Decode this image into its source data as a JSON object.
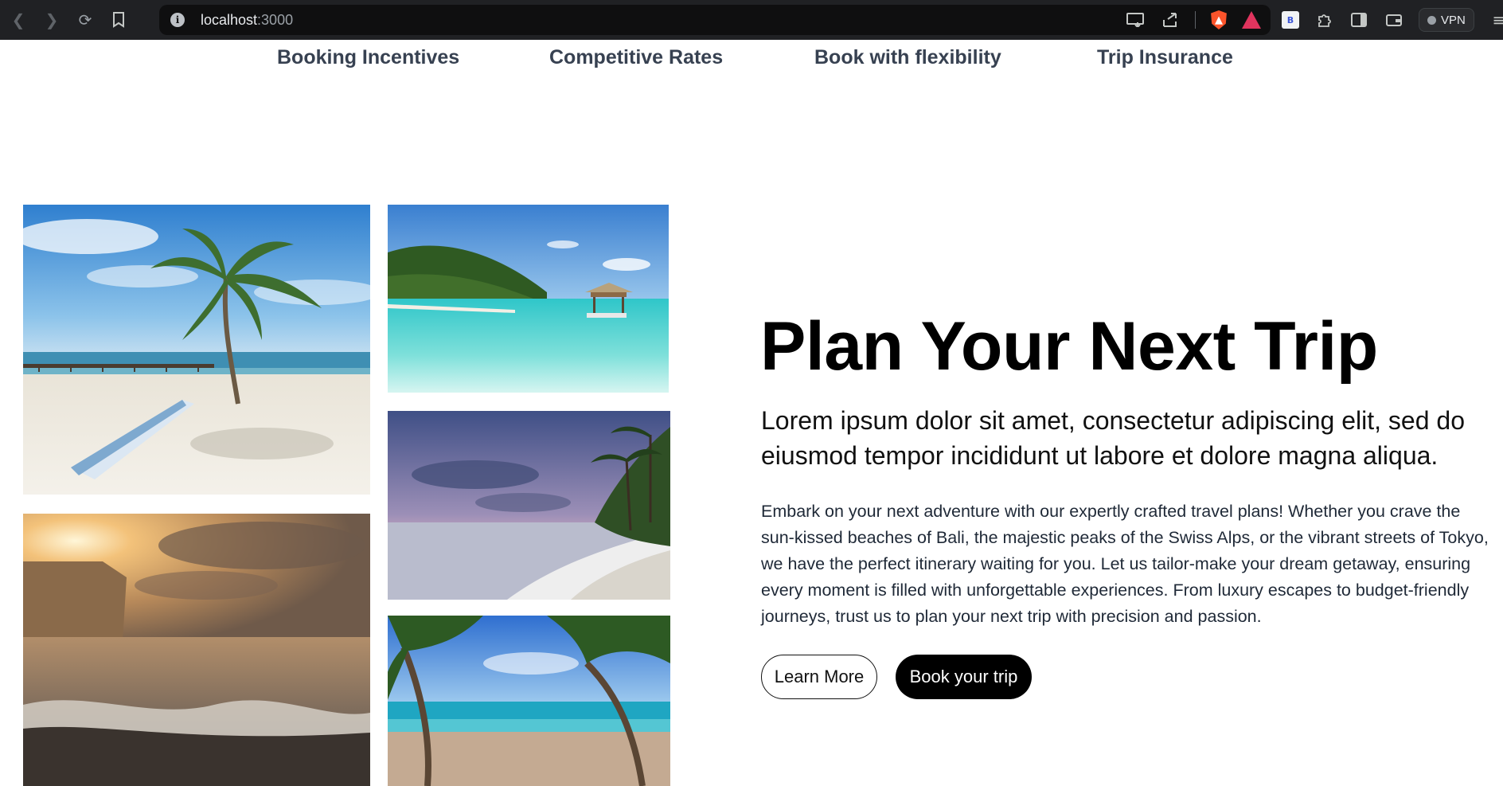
{
  "browser": {
    "url_host": "localhost",
    "url_port": ":3000",
    "vpn_label": "VPN",
    "extension_letter": "B"
  },
  "nav": {
    "items": [
      {
        "label": "Booking Incentives"
      },
      {
        "label": "Competitive Rates"
      },
      {
        "label": "Book with flexibility"
      },
      {
        "label": "Trip Insurance"
      }
    ]
  },
  "gallery": {
    "images": [
      {
        "subject": "beach with palm tree, boat and pier"
      },
      {
        "subject": "tropical lagoon with hut on stilts"
      },
      {
        "subject": "beach at dusk with palm trees"
      },
      {
        "subject": "sunset over rocky shore with waves"
      },
      {
        "subject": "palm trees framing turquoise sea"
      }
    ]
  },
  "hero": {
    "title": "Plan Your Next Trip",
    "lead": "Lorem ipsum dolor sit amet, consectetur adipiscing elit, sed do eiusmod tempor incididunt ut labore et dolore magna aliqua.",
    "body": "Embark on your next adventure with our expertly crafted travel plans! Whether you crave the sun-kissed beaches of Bali, the majestic peaks of the Swiss Alps, or the vibrant streets of Tokyo, we have the perfect itinerary waiting for you. Let us tailor-make your dream getaway, ensuring every moment is filled with unforgettable experiences. From luxury escapes to budget-friendly journeys, trust us to plan your next trip with precision and passion.",
    "learn_more_label": "Learn More",
    "book_label": "Book your trip"
  },
  "colors": {
    "chrome_bg": "#202124",
    "nav_text": "#374151",
    "primary_button": "#000000"
  }
}
